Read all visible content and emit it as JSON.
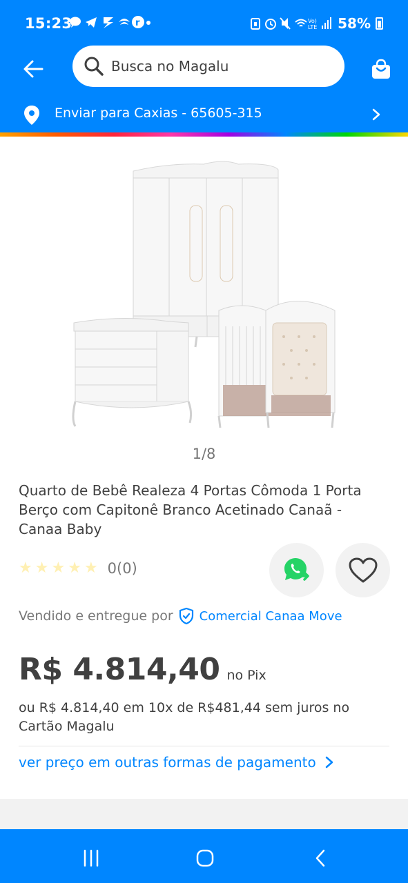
{
  "status_bar": {
    "time": "15:23",
    "battery": "58%",
    "app_icons": [
      "chat-icon",
      "telegram-icon",
      "app-icon",
      "santander-icon",
      "r-icon",
      "dot"
    ],
    "system_icons": [
      "alarm-icon",
      "mute-icon",
      "wifi-6-icon",
      "volte-icon",
      "signal-icon",
      "battery-icon"
    ]
  },
  "header": {
    "search_placeholder": "Busca no Magalu",
    "location_text": "Enviar para Caxias - 65605-315"
  },
  "gallery": {
    "page_indicator": "1/8",
    "image_description_icon": "baby-room-furniture-image"
  },
  "product": {
    "title": "Quarto de Bebê Realeza 4 Portas Cômoda 1 Porta Berço com Capitonê Branco Acetinado Canaã - Canaa Baby",
    "rating": {
      "stars_filled": 0,
      "stars_total": 5,
      "count": "0(0)"
    },
    "seller_label": "Vendido e entregue por",
    "seller_name": "Comercial Canaa Move",
    "price": "R$ 4.814,40",
    "price_suffix": "no Pix",
    "installments": "ou R$ 4.814,40 em 10x de R$481,44 sem juros no Cartão Magalu",
    "other_payments": "ver preço em outras formas de pagamento"
  },
  "colors": {
    "brand_blue": "#0086ff",
    "text_dark": "#404040",
    "text_gray": "#777777",
    "star_empty": "#fff0b3",
    "whatsapp_green": "#25d366"
  }
}
